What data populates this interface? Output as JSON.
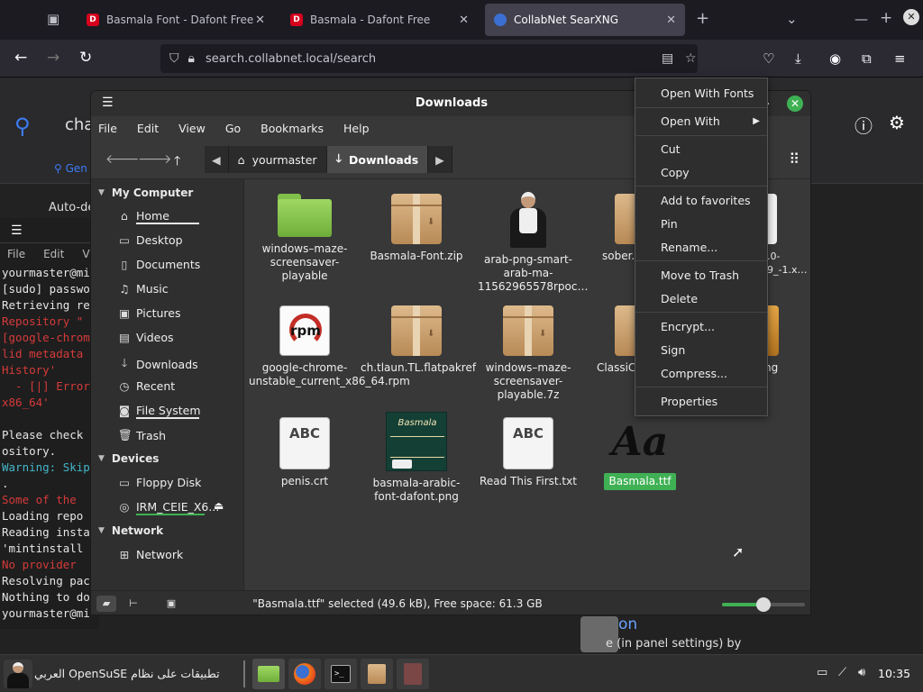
{
  "browser": {
    "tabs": [
      {
        "label": "Basmala Font - Dafont Free",
        "favicon": "D"
      },
      {
        "label": "Basmala - Dafont Free",
        "favicon": "D"
      },
      {
        "label": "CollabNet SearXNG",
        "favicon": ""
      }
    ],
    "url": "search.collabnet.local/search"
  },
  "web": {
    "query_partial": "cha",
    "general_partial": "Gen",
    "auto_detect_partial": "Auto-de",
    "suggestion_partial": "on",
    "suggestion_text_partial": "e (in panel settings) by"
  },
  "terminal": {
    "menu": [
      "File",
      "Edit",
      "View"
    ],
    "lines": [
      {
        "text": "yourmaster@mi",
        "color": "normal"
      },
      {
        "text": "[sudo] passwo",
        "color": "normal"
      },
      {
        "text": "Retrieving re",
        "color": "normal"
      },
      {
        "text": "Repository \"",
        "color": "red"
      },
      {
        "text": "[google-chrom",
        "color": "red"
      },
      {
        "text": "lid metadata",
        "color": "red"
      },
      {
        "text": "History'",
        "color": "red"
      },
      {
        "text": "  - [|] Error",
        "color": "red"
      },
      {
        "text": "x86_64'",
        "color": "red"
      },
      {
        "text": "",
        "color": "normal"
      },
      {
        "text": "Please check",
        "color": "normal"
      },
      {
        "text": "ository.",
        "color": "normal"
      },
      {
        "text": "Warning: Skip",
        "color": "cyan"
      },
      {
        "text": ".",
        "color": "normal"
      },
      {
        "text": "Some of the",
        "color": "red"
      },
      {
        "text": "Loading repo",
        "color": "normal"
      },
      {
        "text": "Reading insta",
        "color": "normal"
      },
      {
        "text": "'mintinstall",
        "color": "normal"
      },
      {
        "text": "No provider",
        "color": "red"
      },
      {
        "text": "Resolving pac",
        "color": "normal"
      },
      {
        "text": "Nothing to do",
        "color": "normal"
      },
      {
        "text": "yourmaster@mi",
        "color": "normal"
      }
    ]
  },
  "nemo": {
    "title": "Downloads",
    "menu": [
      "File",
      "Edit",
      "View",
      "Go",
      "Bookmarks",
      "Help"
    ],
    "breadcrumbs": [
      "yourmaster",
      "Downloads"
    ],
    "sidebar": {
      "my_computer": "My Computer",
      "items": [
        "Home",
        "Desktop",
        "Documents",
        "Music",
        "Pictures",
        "Videos",
        "Downloads",
        "Recent",
        "File System",
        "Trash"
      ],
      "devices_header": "Devices",
      "devices": [
        "Floppy Disk",
        "IRM_CEIE_X6..."
      ],
      "network_header": "Network",
      "network": [
        "Network"
      ]
    },
    "files": [
      {
        "label": "windows–maze-screensaver-playable",
        "kind": "folder"
      },
      {
        "label": "Basmala-Font.zip",
        "kind": "archive"
      },
      {
        "label": "arab-png-smart-arab-ma-11562965578rpoc…",
        "kind": "image-person"
      },
      {
        "label": "sober.f",
        "kind": "archive-partial"
      },
      {
        "label": "7.0-79_-1.x…",
        "kind": "partial-text"
      },
      {
        "label": "google-chrome-unstable_current_x86_64.rpm",
        "kind": "rpm"
      },
      {
        "label": "ch.tlaun.TL.flatpakref",
        "kind": "archive"
      },
      {
        "label": "windows–maze-screensaver-playable.7z",
        "kind": "archive"
      },
      {
        "label": "ClassiC",
        "kind": "archive-partial"
      },
      {
        "label": "ng",
        "kind": "partial-text"
      },
      {
        "label": "penis.crt",
        "kind": "doc"
      },
      {
        "label": "basmala-arabic-font-dafont.png",
        "kind": "image-thumb"
      },
      {
        "label": "Read This First.txt",
        "kind": "doc"
      },
      {
        "label": "Basmala.ttf",
        "kind": "font",
        "selected": true
      }
    ],
    "doc_icon_text": "ABC",
    "rpm_icon_text": "rpm",
    "thumb_text": "Basmala",
    "font_icon_text": "Aa",
    "status": "\"Basmala.ttf\" selected (49.6 kB), Free space: 61.3 GB",
    "zoom_level": 0.5
  },
  "context_menu": {
    "items": [
      "Open With Fonts",
      "Open With",
      "Cut",
      "Copy",
      "Add to favorites",
      "Pin",
      "Rename...",
      "Move to Trash",
      "Delete",
      "Encrypt...",
      "Sign",
      "Compress...",
      "Properties"
    ]
  },
  "taskbar": {
    "label": "تطبيقات على نظام OpenSuSE العربي",
    "clock": "10:35"
  },
  "colors": {
    "accent": "#3fb154",
    "search_blue": "#3d7cf5"
  }
}
